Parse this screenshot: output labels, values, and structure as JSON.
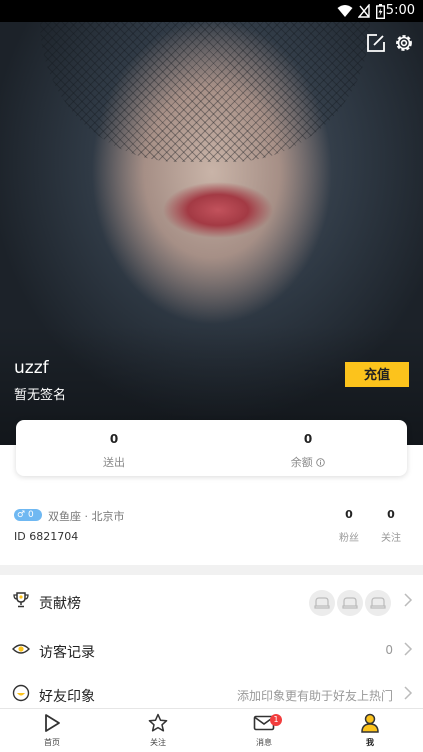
{
  "status_bar": {
    "time": "5:00"
  },
  "profile": {
    "username": "uzzf",
    "signature": "暂无签名",
    "recharge_label": "充值"
  },
  "stats": {
    "sent_value": "0",
    "sent_label": "送出",
    "balance_value": "0",
    "balance_label": "余额"
  },
  "info": {
    "gender_badge": "0",
    "location": "双鱼座 · 北京市",
    "id_text": "ID 6821704",
    "fans_value": "0",
    "fans_label": "粉丝",
    "follow_value": "0",
    "follow_label": "关注"
  },
  "menu": {
    "contribution": {
      "label": "贡献榜"
    },
    "visitors": {
      "label": "访客记录",
      "count": "0"
    },
    "impression": {
      "label": "好友印象",
      "hint": "添加印象更有助于好友上热门"
    }
  },
  "nav": {
    "home": "首页",
    "follow": "关注",
    "messages": "消息",
    "messages_badge": "1",
    "me": "我"
  },
  "colors": {
    "accent": "#fcc31c",
    "badge_red": "#f23d3d",
    "gender_blue": "#6fb8f2"
  }
}
